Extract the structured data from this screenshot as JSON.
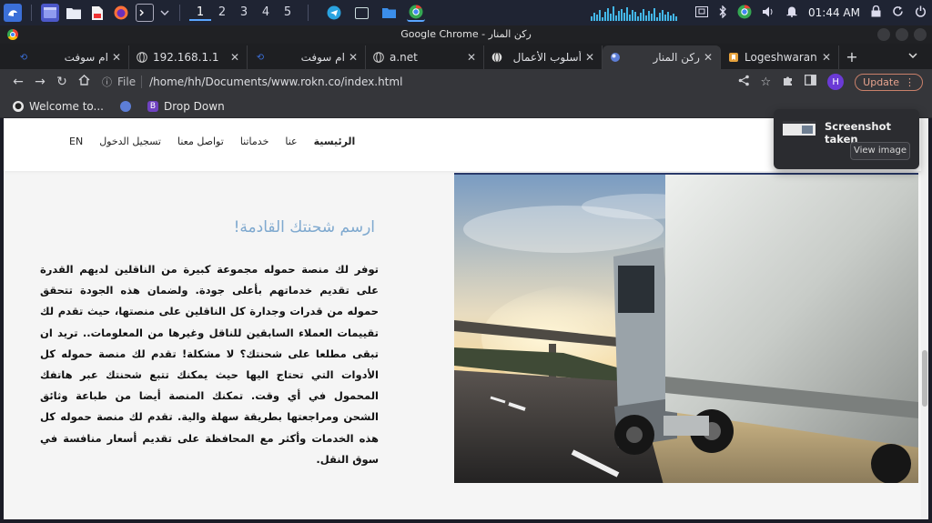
{
  "taskbar": {
    "workspaces": [
      "1",
      "2",
      "3",
      "4",
      "5"
    ],
    "active_workspace": "1",
    "clock": "01:44 AM",
    "icons": [
      "launcher-icon",
      "window-icon",
      "folder-icon",
      "document-icon",
      "firefox-icon",
      "terminal-icon",
      "chevron-down-icon"
    ],
    "tray_icons": [
      "screenshot-icon",
      "bluetooth-icon",
      "chrome-icon",
      "volume-icon",
      "bell-icon",
      "lock-icon",
      "refresh-icon",
      "power-icon"
    ]
  },
  "window": {
    "title": "Google Chrome - ركن المنار"
  },
  "tabs": [
    {
      "title": "ام سوفت",
      "favicon": "soft-icon",
      "active": false
    },
    {
      "title": "192.168.1.1",
      "favicon": "globe-icon",
      "active": false
    },
    {
      "title": "ام سوفت",
      "favicon": "soft-icon",
      "active": false
    },
    {
      "title": "a.net",
      "favicon": "globe-icon",
      "active": false
    },
    {
      "title": "أسلوب الأعمال",
      "favicon": "globe-icon",
      "active": false
    },
    {
      "title": "ركن المنار",
      "favicon": "site-icon",
      "active": true
    },
    {
      "title": "Logeshwaran.o",
      "favicon": "bookmark-icon",
      "active": false
    }
  ],
  "toolbar": {
    "scheme_label": "File",
    "url": "/home/hh/Documents/www.rokn.co/index.html",
    "profile_initial": "H",
    "update_label": "Update"
  },
  "bookmarks": [
    {
      "label": "Welcome to...",
      "icon": "github-icon"
    },
    {
      "label": "",
      "icon": "site-icon"
    },
    {
      "label": "Drop Down",
      "icon": "bootstrap-icon"
    }
  ],
  "site": {
    "nav": [
      "الرئيسية",
      "عنا",
      "خدماتنا",
      "تواصل معنا",
      "تسجيل الدخول",
      "EN"
    ],
    "heading": "ارسم شحنتك القادمة!",
    "body": "توفر لك منصة حموله مجموعة كبيرة من الناقلين لديهم القدرة على تقديم خدماتهم بأعلى جودة. ولضمان هذه الجودة تتحقق حموله من قدرات وجدارة كل الناقلين على منصتها، حيث تقدم لك تقييمات العملاء السابقين للناقل وغيرها من المعلومات.. تريد ان تبقى مطلعا على شحنتك؟ لا مشكلة! تقدم لك منصة حموله كل الأدوات التي تحتاج اليها حيث يمكنك تتبع شحنتك عبر هاتفك المحمول في أي وقت. تمكنك المنصة أيضا من طباعة وثائق الشحن ومراجعتها بطريقة سهلة والية. تقدم لك منصة حموله كل هذه الخدمات وأكثر مع المحافظة على تقديم أسعار منافسة في سوق النقل."
  },
  "notification": {
    "title": "Screenshot taken",
    "button": "View image"
  },
  "colors": {
    "heading": "#7fa9cf",
    "update": "#e8a48f",
    "profile": "#6b3ad6"
  }
}
